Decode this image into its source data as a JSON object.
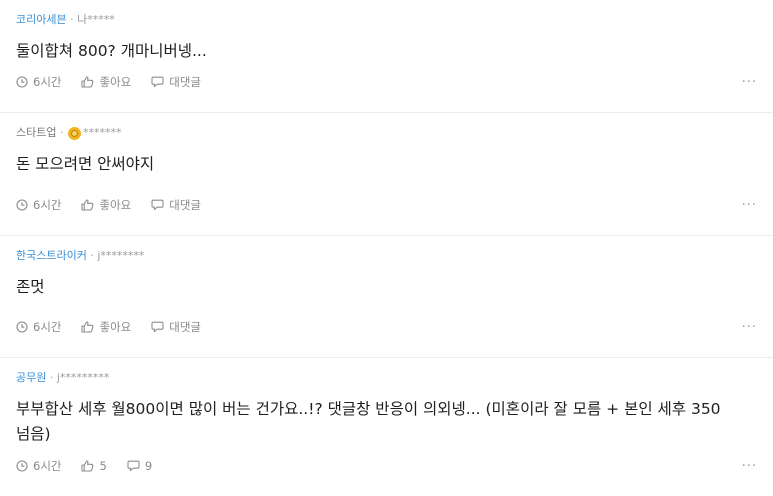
{
  "comments": [
    {
      "company": "코리아세븐",
      "separator": "·",
      "author": "나*****",
      "text": "둘이합쳐 800? 개마니버넹...",
      "time": "6시간",
      "like_label": "좋아요",
      "reply_label": "대댓글",
      "more": "..."
    },
    {
      "company": "스타트업",
      "separator": "·",
      "author": "*******",
      "text": "돈 모으려면 안써야지",
      "time": "6시간",
      "like_label": "좋아요",
      "reply_label": "대댓글",
      "more": "..."
    },
    {
      "company": "한국스트라이커",
      "separator": "·",
      "author": "j********",
      "text": "존멋",
      "time": "6시간",
      "like_label": "좋아요",
      "reply_label": "대댓글",
      "more": "..."
    },
    {
      "company": "공무원",
      "separator": "·",
      "author": "j*********",
      "text": "부부합산 세후 월800이면 많이 버는 건가요..!? 댓글창 반응이 의외넹... (미혼이라 잘 모름 + 본인 세후 350 넘음)",
      "time": "6시간",
      "like_label": "5",
      "reply_label": "9",
      "more": "..."
    }
  ],
  "colors": {
    "company_link": "#3a8fd6",
    "muted": "#8a8a8a",
    "divider": "#ececec"
  }
}
